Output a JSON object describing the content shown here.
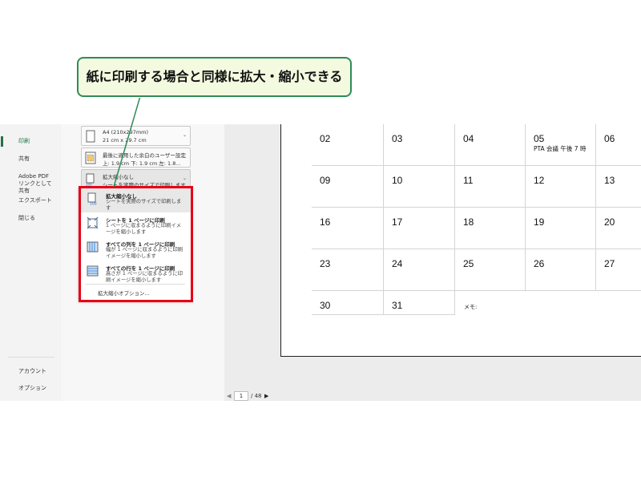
{
  "callout": {
    "text": "紙に印刷する場合と同様に拡大・縮小できる"
  },
  "nav": {
    "items": [
      {
        "label": "印刷",
        "active": true
      },
      {
        "label": "共有"
      },
      {
        "label": "Adobe PDF リンクとして共有"
      },
      {
        "label": "エクスポート"
      },
      {
        "label": "閉じる"
      }
    ],
    "bottom": [
      {
        "label": "アカウント"
      },
      {
        "label": "オプション"
      }
    ]
  },
  "settings": {
    "paper": {
      "line1": "A4 (210x297mm)",
      "line2": "21 cm x 29.7 cm",
      "icon": "page-icon"
    },
    "margins": {
      "line1": "最後に適用した余白のユーザー設定",
      "line2": "上: 1.9 cm 下: 1.9 cm 左: 1.8...",
      "icon": "margins-icon"
    },
    "scaling": {
      "line1": "拡大縮小なし",
      "line2": "シートを実際のサイズで印刷します",
      "icon": "scale-100-icon"
    }
  },
  "dropdown": {
    "items": [
      {
        "title": "拡大縮小なし",
        "desc": "シートを実際のサイズで印刷します",
        "icon": "scale-100-icon",
        "selected": true
      },
      {
        "title": "シートを 1 ページに印刷",
        "desc": "1 ページに収まるように印刷イメージを縮小します",
        "icon": "fit-sheet-icon"
      },
      {
        "title": "すべての列を 1 ページに印刷",
        "desc": "幅が 1 ページに収まるように印刷イメージを縮小します",
        "icon": "fit-columns-icon"
      },
      {
        "title": "すべての行を 1 ページに印刷",
        "desc": "高さが 1 ページに収まるように印刷イメージを縮小します",
        "icon": "fit-rows-icon"
      }
    ],
    "options_link": "拡大縮小オプション..."
  },
  "calendar": {
    "rows": [
      [
        {
          "day": "02"
        },
        {
          "day": "03"
        },
        {
          "day": "04"
        },
        {
          "day": "05",
          "note": "PTA 会議 午後 7 時"
        },
        {
          "day": "06"
        }
      ],
      [
        {
          "day": "09"
        },
        {
          "day": "10"
        },
        {
          "day": "11"
        },
        {
          "day": "12"
        },
        {
          "day": "13"
        }
      ],
      [
        {
          "day": "16"
        },
        {
          "day": "17"
        },
        {
          "day": "18"
        },
        {
          "day": "19"
        },
        {
          "day": "20"
        }
      ],
      [
        {
          "day": "23"
        },
        {
          "day": "24"
        },
        {
          "day": "25"
        },
        {
          "day": "26"
        },
        {
          "day": "27"
        }
      ],
      [
        {
          "day": "30"
        },
        {
          "day": "31"
        }
      ]
    ],
    "memo_label": "メモ:"
  },
  "pager": {
    "current": "1",
    "total": "/ 48",
    "prev_icon": "prev-arrow-icon",
    "next_icon": "next-arrow-icon"
  },
  "colors": {
    "accent": "#217346",
    "highlight": "#e60012",
    "callout_border": "#2e8b57",
    "callout_bg": "#f4fae0"
  }
}
